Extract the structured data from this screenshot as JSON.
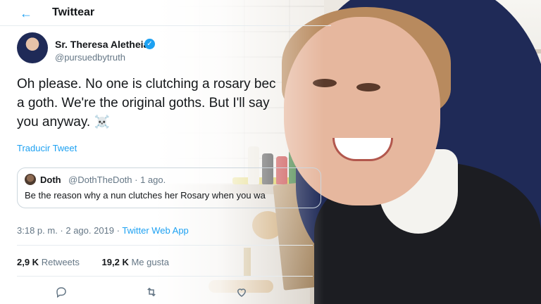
{
  "header": {
    "title": "Twittear"
  },
  "author": {
    "name": "Sr. Theresa Aletheia",
    "handle": "@pursuedbytruth"
  },
  "tweet": {
    "line1": "Oh please. No one is clutching a rosary bec",
    "line2": "a goth. We're the original goths. But I'll say",
    "line3": "you anyway.",
    "emoji": "☠️",
    "translate": "Traducir Tweet"
  },
  "quote": {
    "name": "Doth",
    "handle": "@DothTheDoth · 1 ago.",
    "text": "Be the reason why a nun clutches her Rosary when you wa"
  },
  "meta": {
    "timestamp": "3:18 p. m. · 2 ago. 2019 · ",
    "source": "Twitter Web App"
  },
  "stats": {
    "retweets_count": "2,9 K",
    "retweets_label": "Retweets",
    "likes_count": "19,2 K",
    "likes_label": "Me gusta"
  },
  "icons": [
    "back-arrow-icon",
    "verified-icon",
    "skull-icon",
    "reply-icon",
    "retweet-icon",
    "like-icon"
  ],
  "colors": {
    "accent": "#1da1f2",
    "text": "#14171a",
    "muted": "#657786"
  }
}
